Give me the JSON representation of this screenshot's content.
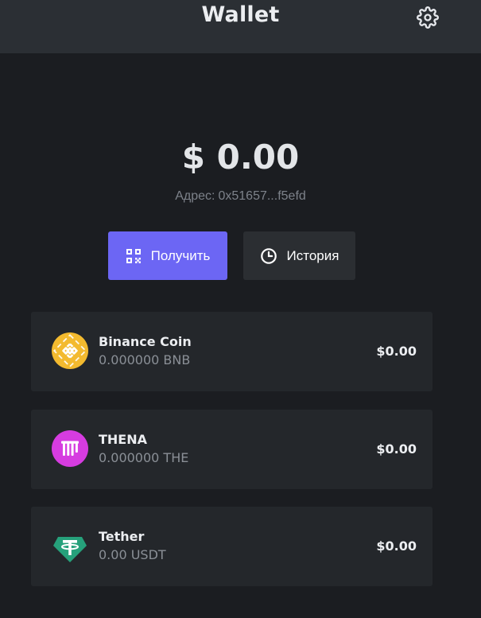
{
  "header": {
    "title": "Wallet",
    "settings_icon": "gear-icon"
  },
  "balance": {
    "total": "$ 0.00",
    "address_label": "Адрес:",
    "address_value": "0x51657...f5efd"
  },
  "actions": {
    "receive": {
      "label": "Получить",
      "icon": "qr-code-icon",
      "color": "#6c66f4"
    },
    "history": {
      "label": "История",
      "icon": "clock-icon",
      "color": "#2b2e32"
    }
  },
  "tokens": [
    {
      "name": "Binance Coin",
      "amount": "0.000000 BNB",
      "value": "$0.00",
      "icon": "bnb-logo-icon",
      "color": "#f3ba2f"
    },
    {
      "name": "THENA",
      "amount": "0.000000 THE",
      "value": "$0.00",
      "icon": "thena-logo-icon",
      "color": "#d63ce0"
    },
    {
      "name": "Tether",
      "amount": "0.00 USDT",
      "value": "$0.00",
      "icon": "tether-logo-icon",
      "color": "#26a17b"
    }
  ]
}
